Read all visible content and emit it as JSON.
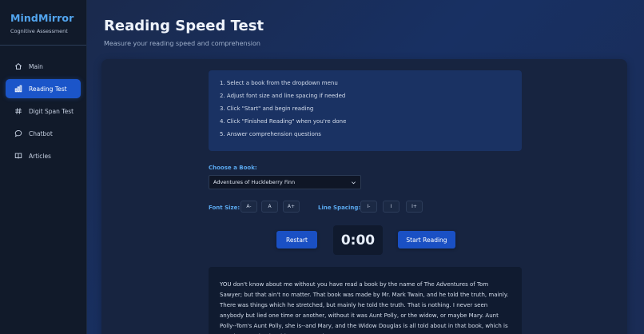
{
  "brand": {
    "title": "MindMirror",
    "subtitle": "Cognitive Assessment"
  },
  "nav": [
    {
      "label": "Main",
      "icon": "home-icon",
      "active": false
    },
    {
      "label": "Reading Test",
      "icon": "bar-chart-icon",
      "active": true
    },
    {
      "label": "Digit Span Test",
      "icon": "hash-icon",
      "active": false
    },
    {
      "label": "Chatbot",
      "icon": "chat-bubble-icon",
      "active": false
    },
    {
      "label": "Articles",
      "icon": "book-icon",
      "active": false
    }
  ],
  "page": {
    "title": "Reading Speed Test",
    "subtitle": "Measure your reading speed and comprehension"
  },
  "instructions": [
    "1. Select a book from the dropdown menu",
    "2. Adjust font size and line spacing if needed",
    "3. Click \"Start\" and begin reading",
    "4. Click \"Finished Reading\" when you're done",
    "5. Answer comprehension questions"
  ],
  "book": {
    "label": "Choose a Book:",
    "selected": "Adventures of Huckleberry Finn"
  },
  "font_size": {
    "label": "Font Size:",
    "buttons": [
      "A-",
      "A",
      "A+"
    ]
  },
  "line_spacing": {
    "label": "Line Spacing:",
    "buttons": [
      "I-",
      "I",
      "I+"
    ]
  },
  "controls": {
    "restart": "Restart",
    "timer": "0:00",
    "start": "Start Reading"
  },
  "reading_text": "YOU don't know about me without you have read a book by the name of The Adventures of Tom Sawyer; but that ain't no matter. That book was made by Mr. Mark Twain, and he told the truth, mainly. There was things which he stretched, but mainly he told the truth. That is nothing. I never seen anybody but lied one time or another, without it was Aunt Polly, or the widow, or maybe Mary. Aunt Polly--Tom's Aunt Polly, she is--and Mary, and the Widow Douglas is all told about in that book, which is mostly a true book, with some stretchers, as I",
  "colors": {
    "accent": "#52a5ef",
    "active_nav": "#1b55c9",
    "primary_button": "#1a50c4",
    "sidebar_bg": "#111a2a",
    "card_bg": "#172440"
  }
}
